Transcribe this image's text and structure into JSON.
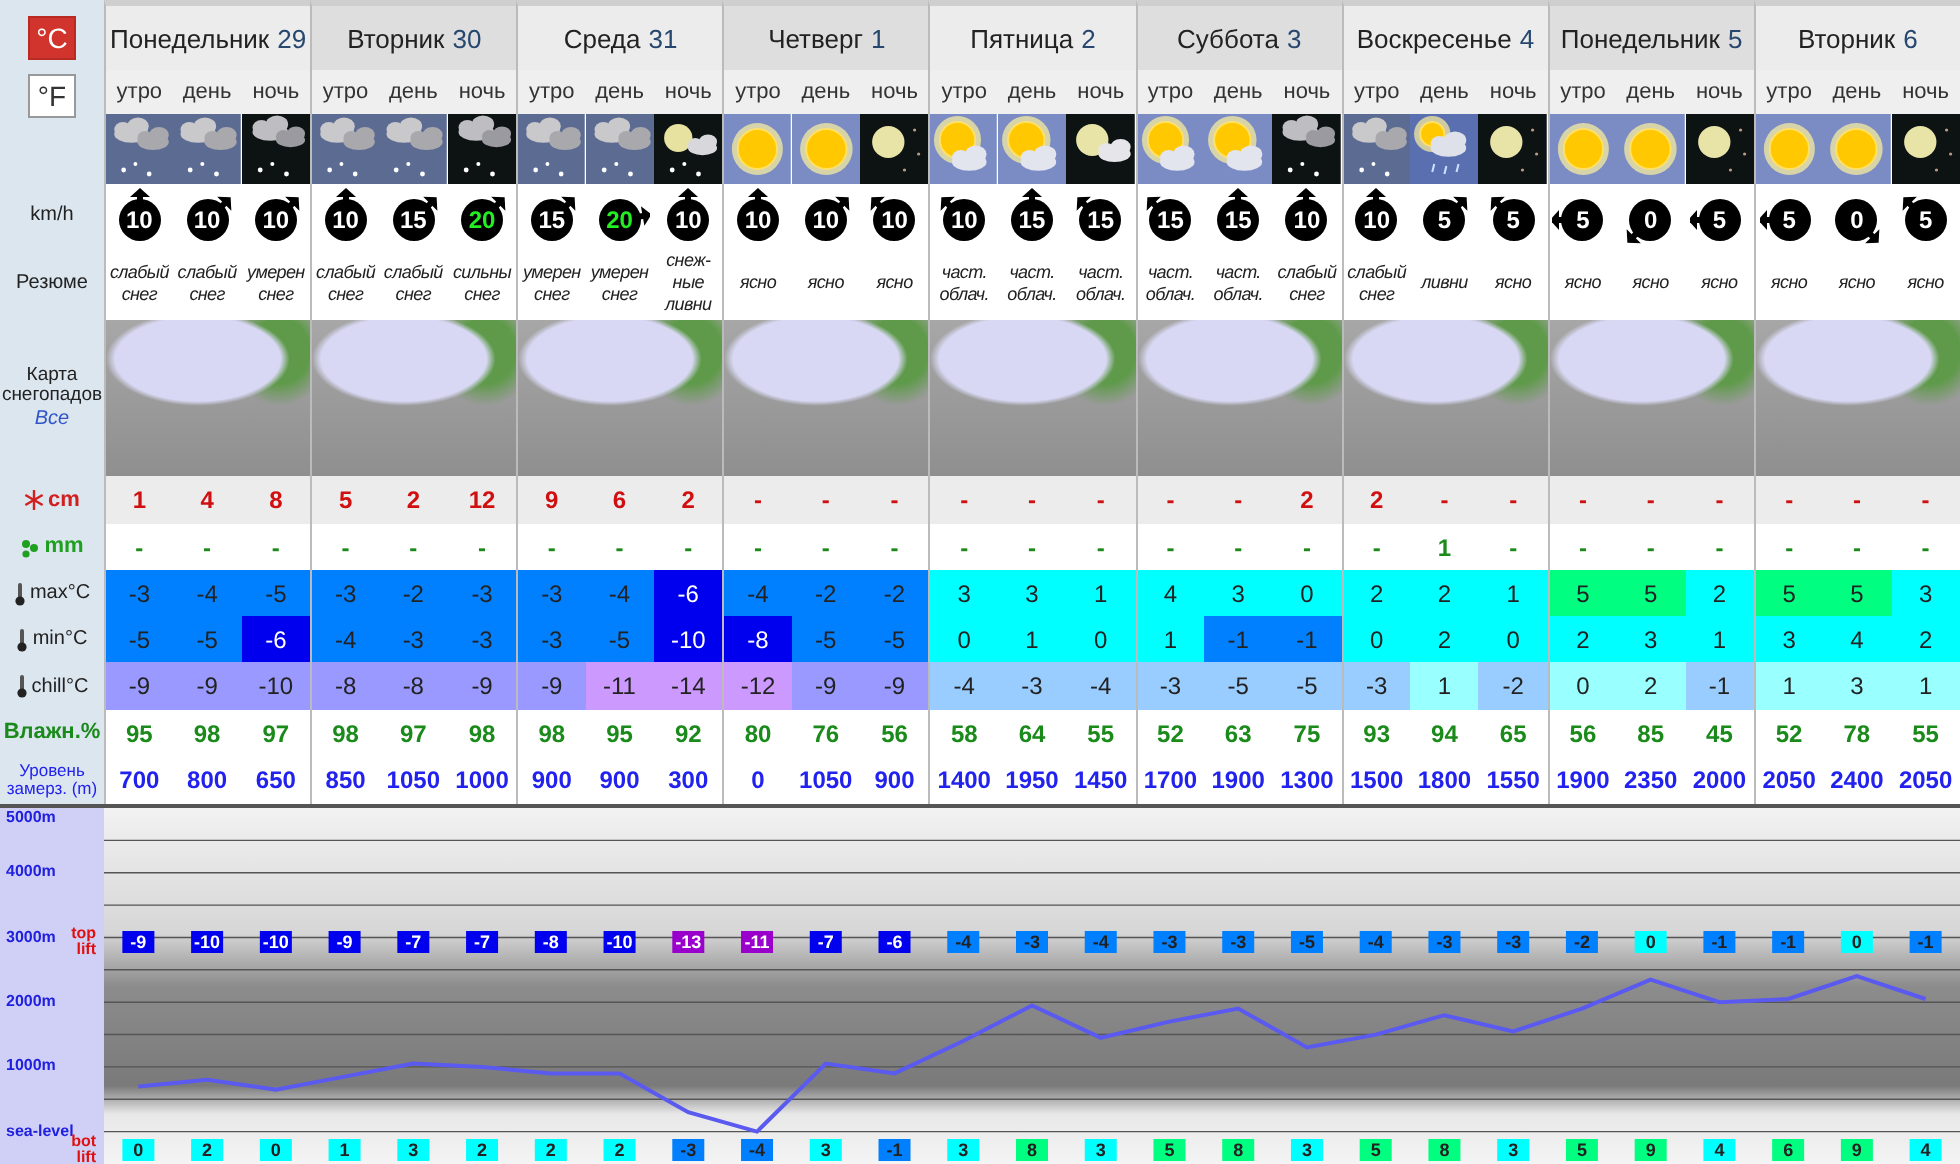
{
  "units": [
    {
      "label": "°C",
      "selected": true
    },
    {
      "label": "°F",
      "selected": false
    }
  ],
  "row_labels": {
    "wind": "km/h",
    "summary": "Резюме",
    "map": "Карта снегопадов",
    "map_link": "Все",
    "snow": "cm",
    "rain": "mm",
    "max": "max°C",
    "min": "min°C",
    "chill": "chill°C",
    "humidity": "Влажн.%",
    "freezing": "Уровень замерз. (m)"
  },
  "days": [
    {
      "name": "Понедельник",
      "date": "29",
      "periods": [
        {
          "label": "утро",
          "kind": "snow",
          "wind": {
            "value": "10",
            "kind": "N",
            "color": "#ffffff"
          },
          "summary": "слабый снег",
          "snow": "1",
          "rain": "-",
          "max": {
            "value": "-3",
            "color": "#0080ff"
          },
          "min": {
            "value": "-5",
            "color": "#0080ff"
          },
          "chill": {
            "value": "-9",
            "color": "#9999ff"
          },
          "humidity": "95",
          "freezing": "700"
        },
        {
          "label": "день",
          "kind": "snow",
          "wind": {
            "value": "10",
            "kind": "NE",
            "color": "#ffffff"
          },
          "summary": "слабый снег",
          "snow": "4",
          "rain": "-",
          "max": {
            "value": "-4",
            "color": "#0080ff"
          },
          "min": {
            "value": "-5",
            "color": "#0080ff"
          },
          "chill": {
            "value": "-9",
            "color": "#9999ff"
          },
          "humidity": "98",
          "freezing": "800"
        },
        {
          "label": "ночь",
          "kind": "night_snow",
          "wind": {
            "value": "10",
            "kind": "NE",
            "color": "#ffffff"
          },
          "summary": "умерен снег",
          "snow": "8",
          "rain": "-",
          "max": {
            "value": "-5",
            "color": "#0080ff"
          },
          "min": {
            "value": "-6",
            "color": "#0000ee"
          },
          "chill": {
            "value": "-10",
            "color": "#9999ff"
          },
          "humidity": "97",
          "freezing": "650"
        }
      ]
    },
    {
      "name": "Вторник",
      "date": "30",
      "periods": [
        {
          "label": "утро",
          "kind": "snow",
          "wind": {
            "value": "10",
            "kind": "N",
            "color": "#ffffff"
          },
          "summary": "слабый снег",
          "snow": "5",
          "rain": "-",
          "max": {
            "value": "-3",
            "color": "#0080ff"
          },
          "min": {
            "value": "-4",
            "color": "#0080ff"
          },
          "chill": {
            "value": "-8",
            "color": "#9999ff"
          },
          "humidity": "98",
          "freezing": "850"
        },
        {
          "label": "день",
          "kind": "snow",
          "wind": {
            "value": "15",
            "kind": "NE",
            "color": "#ffffff"
          },
          "summary": "слабый снег",
          "snow": "2",
          "rain": "-",
          "max": {
            "value": "-2",
            "color": "#0080ff"
          },
          "min": {
            "value": "-3",
            "color": "#0080ff"
          },
          "chill": {
            "value": "-8",
            "color": "#9999ff"
          },
          "humidity": "97",
          "freezing": "1050"
        },
        {
          "label": "ночь",
          "kind": "night_snow",
          "wind": {
            "value": "20",
            "kind": "NE",
            "color": "#22ee22"
          },
          "summary": "сильны снег",
          "snow": "12",
          "rain": "-",
          "max": {
            "value": "-3",
            "color": "#0080ff"
          },
          "min": {
            "value": "-3",
            "color": "#0080ff"
          },
          "chill": {
            "value": "-9",
            "color": "#9999ff"
          },
          "humidity": "98",
          "freezing": "1000"
        }
      ]
    },
    {
      "name": "Среда",
      "date": "31",
      "periods": [
        {
          "label": "утро",
          "kind": "snow",
          "wind": {
            "value": "15",
            "kind": "NE",
            "color": "#ffffff"
          },
          "summary": "умерен снег",
          "snow": "9",
          "rain": "-",
          "max": {
            "value": "-3",
            "color": "#0080ff"
          },
          "min": {
            "value": "-3",
            "color": "#0080ff"
          },
          "chill": {
            "value": "-9",
            "color": "#9999ff"
          },
          "humidity": "98",
          "freezing": "900"
        },
        {
          "label": "день",
          "kind": "snow",
          "wind": {
            "value": "20",
            "kind": "E",
            "color": "#22ee22"
          },
          "summary": "умерен снег",
          "snow": "6",
          "rain": "-",
          "max": {
            "value": "-4",
            "color": "#0080ff"
          },
          "min": {
            "value": "-5",
            "color": "#0080ff"
          },
          "chill": {
            "value": "-11",
            "color": "#cc99ff"
          },
          "humidity": "95",
          "freezing": "900"
        },
        {
          "label": "ночь",
          "kind": "night_moon_snow",
          "wind": {
            "value": "10",
            "kind": "N",
            "color": "#ffffff"
          },
          "summary": "снеж-ные ливни",
          "snow": "2",
          "rain": "-",
          "max": {
            "value": "-6",
            "color": "#0000ee"
          },
          "min": {
            "value": "-10",
            "color": "#0000ee"
          },
          "chill": {
            "value": "-14",
            "color": "#cc99ff"
          },
          "humidity": "92",
          "freezing": "300"
        }
      ]
    },
    {
      "name": "Четверг",
      "date": "1",
      "periods": [
        {
          "label": "утро",
          "kind": "sun",
          "wind": {
            "value": "10",
            "kind": "N",
            "color": "#ffffff"
          },
          "summary": "ясно",
          "snow": "-",
          "rain": "-",
          "max": {
            "value": "-4",
            "color": "#0080ff"
          },
          "min": {
            "value": "-8",
            "color": "#0000ee"
          },
          "chill": {
            "value": "-12",
            "color": "#cc99ff"
          },
          "humidity": "80",
          "freezing": "0"
        },
        {
          "label": "день",
          "kind": "sun",
          "wind": {
            "value": "10",
            "kind": "NE",
            "color": "#ffffff"
          },
          "summary": "ясно",
          "snow": "-",
          "rain": "-",
          "max": {
            "value": "-2",
            "color": "#0080ff"
          },
          "min": {
            "value": "-5",
            "color": "#0080ff"
          },
          "chill": {
            "value": "-9",
            "color": "#9999ff"
          },
          "humidity": "76",
          "freezing": "1050"
        },
        {
          "label": "ночь",
          "kind": "moon",
          "wind": {
            "value": "10",
            "kind": "NW",
            "color": "#ffffff"
          },
          "summary": "ясно",
          "snow": "-",
          "rain": "-",
          "max": {
            "value": "-2",
            "color": "#0080ff"
          },
          "min": {
            "value": "-5",
            "color": "#0080ff"
          },
          "chill": {
            "value": "-9",
            "color": "#9999ff"
          },
          "humidity": "56",
          "freezing": "900"
        }
      ]
    },
    {
      "name": "Пятница",
      "date": "2",
      "periods": [
        {
          "label": "утро",
          "kind": "partly_cloudy",
          "wind": {
            "value": "10",
            "kind": "NW",
            "color": "#ffffff"
          },
          "summary": "част. облач.",
          "snow": "-",
          "rain": "-",
          "max": {
            "value": "3",
            "color": "#00ffff"
          },
          "min": {
            "value": "0",
            "color": "#00ffff"
          },
          "chill": {
            "value": "-4",
            "color": "#99ccff"
          },
          "humidity": "58",
          "freezing": "1400"
        },
        {
          "label": "день",
          "kind": "partly_cloudy",
          "wind": {
            "value": "15",
            "kind": "N",
            "color": "#ffffff"
          },
          "summary": "част. облач.",
          "snow": "-",
          "rain": "-",
          "max": {
            "value": "3",
            "color": "#00ffff"
          },
          "min": {
            "value": "1",
            "color": "#00ffff"
          },
          "chill": {
            "value": "-3",
            "color": "#99ccff"
          },
          "humidity": "64",
          "freezing": "1950"
        },
        {
          "label": "ночь",
          "kind": "night_moon_cloud",
          "wind": {
            "value": "15",
            "kind": "NW",
            "color": "#ffffff"
          },
          "summary": "част. облач.",
          "snow": "-",
          "rain": "-",
          "max": {
            "value": "1",
            "color": "#00ffff"
          },
          "min": {
            "value": "0",
            "color": "#00ffff"
          },
          "chill": {
            "value": "-4",
            "color": "#99ccff"
          },
          "humidity": "55",
          "freezing": "1450"
        }
      ]
    },
    {
      "name": "Суббота",
      "date": "3",
      "periods": [
        {
          "label": "утро",
          "kind": "partly_cloudy",
          "wind": {
            "value": "15",
            "kind": "NW",
            "color": "#ffffff"
          },
          "summary": "част. облач.",
          "snow": "-",
          "rain": "-",
          "max": {
            "value": "4",
            "color": "#00ffff"
          },
          "min": {
            "value": "1",
            "color": "#00ffff"
          },
          "chill": {
            "value": "-3",
            "color": "#99ccff"
          },
          "humidity": "52",
          "freezing": "1700"
        },
        {
          "label": "день",
          "kind": "partly_cloudy",
          "wind": {
            "value": "15",
            "kind": "N",
            "color": "#ffffff"
          },
          "summary": "част. облач.",
          "snow": "-",
          "rain": "-",
          "max": {
            "value": "3",
            "color": "#00ffff"
          },
          "min": {
            "value": "-1",
            "color": "#0080ff"
          },
          "chill": {
            "value": "-5",
            "color": "#99ccff"
          },
          "humidity": "63",
          "freezing": "1900"
        },
        {
          "label": "ночь",
          "kind": "night_snow",
          "wind": {
            "value": "10",
            "kind": "N",
            "color": "#ffffff"
          },
          "summary": "слабый снег",
          "snow": "2",
          "rain": "-",
          "max": {
            "value": "0",
            "color": "#00ffff"
          },
          "min": {
            "value": "-1",
            "color": "#0080ff"
          },
          "chill": {
            "value": "-5",
            "color": "#99ccff"
          },
          "humidity": "75",
          "freezing": "1300"
        }
      ]
    },
    {
      "name": "Воскресенье",
      "date": "4",
      "periods": [
        {
          "label": "утро",
          "kind": "snow",
          "wind": {
            "value": "10",
            "kind": "N",
            "color": "#ffffff"
          },
          "summary": "слабый снег",
          "snow": "2",
          "rain": "-",
          "max": {
            "value": "2",
            "color": "#00ffff"
          },
          "min": {
            "value": "0",
            "color": "#00ffff"
          },
          "chill": {
            "value": "-3",
            "color": "#99ccff"
          },
          "humidity": "93",
          "freezing": "1500"
        },
        {
          "label": "день",
          "kind": "showers",
          "wind": {
            "value": "5",
            "kind": "NE",
            "color": "#ffffff"
          },
          "summary": "ливни",
          "snow": "-",
          "rain": "1",
          "max": {
            "value": "2",
            "color": "#00ffff"
          },
          "min": {
            "value": "2",
            "color": "#00ffff"
          },
          "chill": {
            "value": "1",
            "color": "#99ffff"
          },
          "humidity": "94",
          "freezing": "1800"
        },
        {
          "label": "ночь",
          "kind": "moon",
          "wind": {
            "value": "5",
            "kind": "NW",
            "color": "#ffffff"
          },
          "summary": "ясно",
          "snow": "-",
          "rain": "-",
          "max": {
            "value": "1",
            "color": "#00ffff"
          },
          "min": {
            "value": "0",
            "color": "#00ffff"
          },
          "chill": {
            "value": "-2",
            "color": "#99ccff"
          },
          "humidity": "65",
          "freezing": "1550"
        }
      ]
    },
    {
      "name": "Понедельник",
      "date": "5",
      "periods": [
        {
          "label": "утро",
          "kind": "sun",
          "wind": {
            "value": "5",
            "kind": "W",
            "color": "#ffffff"
          },
          "summary": "ясно",
          "snow": "-",
          "rain": "-",
          "max": {
            "value": "5",
            "color": "#00ff80"
          },
          "min": {
            "value": "2",
            "color": "#00ffff"
          },
          "chill": {
            "value": "0",
            "color": "#99ffff"
          },
          "humidity": "56",
          "freezing": "1900"
        },
        {
          "label": "день",
          "kind": "sun",
          "wind": {
            "value": "0",
            "kind": "SW",
            "color": "#ffffff"
          },
          "summary": "ясно",
          "snow": "-",
          "rain": "-",
          "max": {
            "value": "5",
            "color": "#00ff80"
          },
          "min": {
            "value": "3",
            "color": "#00ffff"
          },
          "chill": {
            "value": "2",
            "color": "#99ffff"
          },
          "humidity": "85",
          "freezing": "2350"
        },
        {
          "label": "ночь",
          "kind": "moon",
          "wind": {
            "value": "5",
            "kind": "W",
            "color": "#ffffff"
          },
          "summary": "ясно",
          "snow": "-",
          "rain": "-",
          "max": {
            "value": "2",
            "color": "#00ffff"
          },
          "min": {
            "value": "1",
            "color": "#00ffff"
          },
          "chill": {
            "value": "-1",
            "color": "#99ccff"
          },
          "humidity": "45",
          "freezing": "2000"
        }
      ]
    },
    {
      "name": "Вторник",
      "date": "6",
      "periods": [
        {
          "label": "утро",
          "kind": "sun",
          "wind": {
            "value": "5",
            "kind": "W",
            "color": "#ffffff"
          },
          "summary": "ясно",
          "snow": "-",
          "rain": "-",
          "max": {
            "value": "5",
            "color": "#00ff80"
          },
          "min": {
            "value": "3",
            "color": "#00ffff"
          },
          "chill": {
            "value": "1",
            "color": "#99ffff"
          },
          "humidity": "52",
          "freezing": "2050"
        },
        {
          "label": "день",
          "kind": "sun",
          "wind": {
            "value": "0",
            "kind": "SE",
            "color": "#ffffff"
          },
          "summary": "ясно",
          "snow": "-",
          "rain": "-",
          "max": {
            "value": "5",
            "color": "#00ff80"
          },
          "min": {
            "value": "4",
            "color": "#00ffff"
          },
          "chill": {
            "value": "3",
            "color": "#99ffff"
          },
          "humidity": "78",
          "freezing": "2400"
        },
        {
          "label": "ночь",
          "kind": "moon",
          "wind": {
            "value": "5",
            "kind": "NW",
            "color": "#ffffff"
          },
          "summary": "ясно",
          "snow": "-",
          "rain": "-",
          "max": {
            "value": "3",
            "color": "#00ffff"
          },
          "min": {
            "value": "2",
            "color": "#00ffff"
          },
          "chill": {
            "value": "1",
            "color": "#99ffff"
          },
          "humidity": "55",
          "freezing": "2050"
        }
      ]
    }
  ],
  "chart": {
    "chart_data": {
      "type": "line",
      "ylim": [
        -500,
        5000
      ],
      "yticks": [
        {
          "value": 0,
          "label": "sea-level"
        },
        {
          "value": 1000,
          "label": "1000m"
        },
        {
          "value": 2000,
          "label": "2000m"
        },
        {
          "value": 3000,
          "label": "3000m"
        },
        {
          "value": 4000,
          "label": "4000m"
        },
        {
          "value": 5000,
          "label": "5000m"
        }
      ],
      "grid": true,
      "series": [
        {
          "color": "#5a5af0",
          "values": [
            700,
            800,
            650,
            850,
            1050,
            1000,
            900,
            900,
            300,
            0,
            1050,
            900,
            1400,
            1950,
            1450,
            1700,
            1900,
            1300,
            1500,
            1800,
            1550,
            1900,
            2350,
            2000,
            2050,
            2400,
            2050
          ]
        }
      ]
    },
    "lifts": [
      {
        "kind": "top",
        "label": "top lift",
        "temps": [
          {
            "value": "-9",
            "color": "#0000ee"
          },
          {
            "value": "-10",
            "color": "#0000ee"
          },
          {
            "value": "-10",
            "color": "#0000ee"
          },
          {
            "value": "-9",
            "color": "#0000ee"
          },
          {
            "value": "-7",
            "color": "#0000ee"
          },
          {
            "value": "-7",
            "color": "#0000ee"
          },
          {
            "value": "-8",
            "color": "#0000ee"
          },
          {
            "value": "-10",
            "color": "#0000ee"
          },
          {
            "value": "-13",
            "color": "#9900cc"
          },
          {
            "value": "-11",
            "color": "#9900cc"
          },
          {
            "value": "-7",
            "color": "#0000ee"
          },
          {
            "value": "-6",
            "color": "#0000ee"
          },
          {
            "value": "-4",
            "color": "#0080ff"
          },
          {
            "value": "-3",
            "color": "#0080ff"
          },
          {
            "value": "-4",
            "color": "#0080ff"
          },
          {
            "value": "-3",
            "color": "#0080ff"
          },
          {
            "value": "-3",
            "color": "#0080ff"
          },
          {
            "value": "-5",
            "color": "#0080ff"
          },
          {
            "value": "-4",
            "color": "#0080ff"
          },
          {
            "value": "-3",
            "color": "#0080ff"
          },
          {
            "value": "-3",
            "color": "#0080ff"
          },
          {
            "value": "-2",
            "color": "#0080ff"
          },
          {
            "value": "0",
            "color": "#00ffff"
          },
          {
            "value": "-1",
            "color": "#0080ff"
          },
          {
            "value": "-1",
            "color": "#0080ff"
          },
          {
            "value": "0",
            "color": "#00ffff"
          },
          {
            "value": "-1",
            "color": "#0080ff"
          }
        ]
      },
      {
        "kind": "bottom",
        "label": "bot lift",
        "temps": [
          {
            "value": "0",
            "color": "#00ffff"
          },
          {
            "value": "2",
            "color": "#00ffff"
          },
          {
            "value": "0",
            "color": "#00ffff"
          },
          {
            "value": "1",
            "color": "#00ffff"
          },
          {
            "value": "3",
            "color": "#00ffff"
          },
          {
            "value": "2",
            "color": "#00ffff"
          },
          {
            "value": "2",
            "color": "#00ffff"
          },
          {
            "value": "2",
            "color": "#00ffff"
          },
          {
            "value": "-3",
            "color": "#0080ff"
          },
          {
            "value": "-4",
            "color": "#0080ff"
          },
          {
            "value": "3",
            "color": "#00ffff"
          },
          {
            "value": "-1",
            "color": "#0080ff"
          },
          {
            "value": "3",
            "color": "#00ffff"
          },
          {
            "value": "8",
            "color": "#00ff80"
          },
          {
            "value": "3",
            "color": "#00ffff"
          },
          {
            "value": "5",
            "color": "#00ff80"
          },
          {
            "value": "8",
            "color": "#00ff80"
          },
          {
            "value": "3",
            "color": "#00ffff"
          },
          {
            "value": "5",
            "color": "#00ff80"
          },
          {
            "value": "8",
            "color": "#00ff80"
          },
          {
            "value": "3",
            "color": "#00ffff"
          },
          {
            "value": "5",
            "color": "#00ff80"
          },
          {
            "value": "9",
            "color": "#00ff80"
          },
          {
            "value": "4",
            "color": "#00ffff"
          },
          {
            "value": "6",
            "color": "#00ff80"
          },
          {
            "value": "9",
            "color": "#00ff80"
          },
          {
            "value": "4",
            "color": "#00ffff"
          }
        ]
      }
    ]
  }
}
